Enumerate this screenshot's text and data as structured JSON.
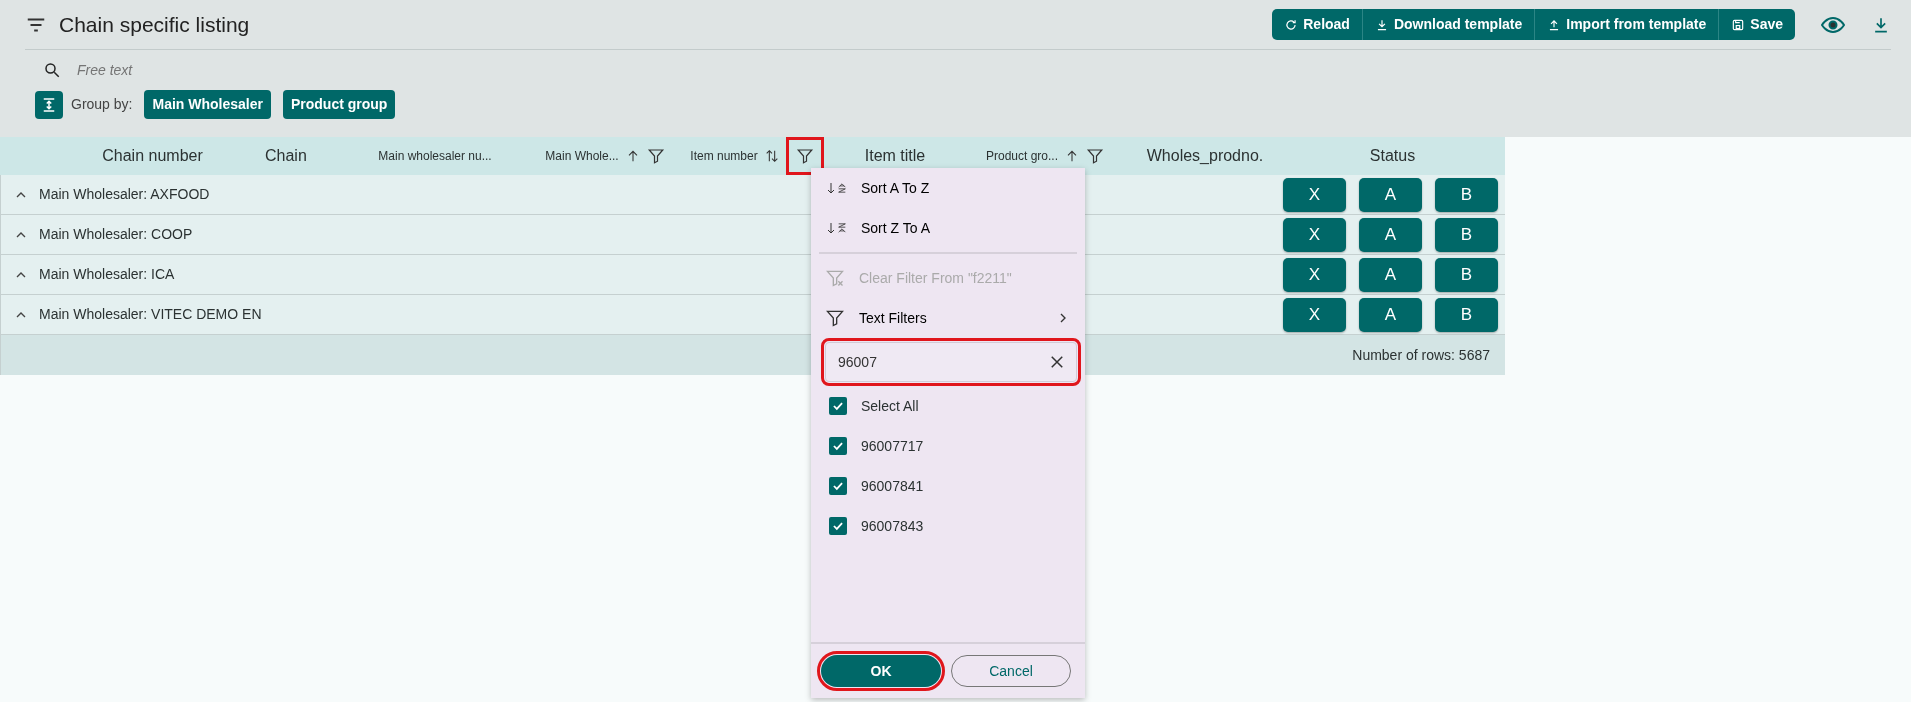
{
  "header": {
    "title": "Chain specific listing",
    "toolbar": [
      "Reload",
      "Download template",
      "Import from template",
      "Save"
    ]
  },
  "search": {
    "placeholder": "Free text"
  },
  "group_by": {
    "label": "Group by:",
    "chips": [
      "Main Wholesaler",
      "Product group"
    ]
  },
  "table": {
    "columns": [
      {
        "label": "Chain number",
        "kind": "plain"
      },
      {
        "label": "Chain",
        "kind": "plain"
      },
      {
        "label": "Main wholesaler nu...",
        "kind": "compact"
      },
      {
        "label": "Main Whole...",
        "kind": "compact",
        "sorted": true,
        "filter": true
      },
      {
        "label": "Item number",
        "kind": "compact",
        "sorted": false,
        "filter": true,
        "highlighted": true
      },
      {
        "label": "Item title",
        "kind": "plain"
      },
      {
        "label": "Product gro...",
        "kind": "compact",
        "sorted": true,
        "filter": true
      },
      {
        "label": "Wholes_prodno.",
        "kind": "plain"
      },
      {
        "label": "Status",
        "kind": "plain"
      }
    ],
    "rows": [
      {
        "label": "Main Wholesaler: AXFOOD",
        "expanded": true,
        "status_buttons": [
          "X",
          "A",
          "B"
        ]
      },
      {
        "label": "Main Wholesaler: COOP",
        "expanded": true,
        "status_buttons": [
          "X",
          "A",
          "B"
        ]
      },
      {
        "label": "Main Wholesaler: ICA",
        "expanded": true,
        "status_buttons": [
          "X",
          "A",
          "B"
        ]
      },
      {
        "label": "Main Wholesaler: VITEC DEMO EN",
        "expanded": true,
        "status_buttons": [
          "X",
          "A",
          "B"
        ]
      }
    ],
    "footer": "Number of rows: 5687"
  },
  "filter_menu": {
    "items": [
      {
        "kind": "sort-az",
        "label": "Sort A To Z",
        "disabled": false
      },
      {
        "kind": "sort-za",
        "label": "Sort Z To A",
        "disabled": false
      },
      {
        "kind": "divider"
      },
      {
        "kind": "clear",
        "label": "Clear Filter From \"f2211\"",
        "disabled": true
      },
      {
        "kind": "submenu",
        "label": "Text Filters",
        "disabled": false
      }
    ],
    "search_value": "96007",
    "search_highlighted": true,
    "options": [
      {
        "label": "Select All",
        "checked": true
      },
      {
        "label": "96007717",
        "checked": true
      },
      {
        "label": "96007841",
        "checked": true
      },
      {
        "label": "96007843",
        "checked": true
      }
    ],
    "ok": {
      "label": "OK",
      "highlighted": true
    },
    "cancel": {
      "label": "Cancel",
      "highlighted": false
    }
  }
}
